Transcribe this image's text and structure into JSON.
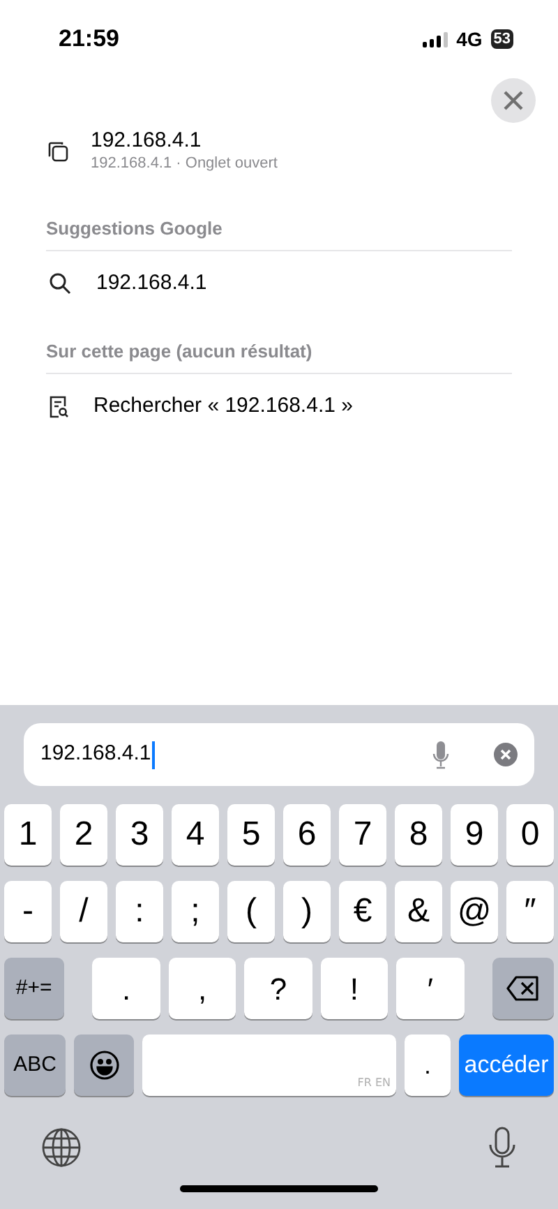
{
  "status_bar": {
    "time": "21:59",
    "network": "4G",
    "battery": "53"
  },
  "open_tab": {
    "title": "192.168.4.1",
    "subtitle": "192.168.4.1 · Onglet ouvert"
  },
  "sections": [
    {
      "header": "Suggestions Google",
      "rows": [
        {
          "kind": "search",
          "text": "192.168.4.1"
        }
      ]
    },
    {
      "header": "Sur cette page (aucun résultat)",
      "rows": [
        {
          "kind": "find",
          "text": "Rechercher « 192.168.4.1 »"
        }
      ]
    }
  ],
  "address_field": {
    "value": "192.168.4.1"
  },
  "keyboard": {
    "rows": [
      {
        "keys": [
          {
            "kind": "char",
            "label": "1"
          },
          {
            "kind": "char",
            "label": "2"
          },
          {
            "kind": "char",
            "label": "3"
          },
          {
            "kind": "char",
            "label": "4"
          },
          {
            "kind": "char",
            "label": "5"
          },
          {
            "kind": "char",
            "label": "6"
          },
          {
            "kind": "char",
            "label": "7"
          },
          {
            "kind": "char",
            "label": "8"
          },
          {
            "kind": "char",
            "label": "9"
          },
          {
            "kind": "char",
            "label": "0"
          }
        ]
      },
      {
        "keys": [
          {
            "kind": "char",
            "label": "-"
          },
          {
            "kind": "char",
            "label": "/"
          },
          {
            "kind": "char",
            "label": ":"
          },
          {
            "kind": "char",
            "label": ";"
          },
          {
            "kind": "char",
            "label": "("
          },
          {
            "kind": "char",
            "label": ")"
          },
          {
            "kind": "char",
            "label": "€"
          },
          {
            "kind": "char",
            "label": "&"
          },
          {
            "kind": "char",
            "label": "@"
          },
          {
            "kind": "char",
            "label": "″"
          }
        ]
      },
      {
        "keys": [
          {
            "kind": "function",
            "label": "#+="
          },
          {
            "kind": "wide",
            "label": "."
          },
          {
            "kind": "wide",
            "label": ","
          },
          {
            "kind": "wide",
            "label": "?"
          },
          {
            "kind": "wide",
            "label": "!"
          },
          {
            "kind": "wide",
            "label": "′"
          },
          {
            "kind": "delete"
          }
        ]
      },
      {
        "keys": [
          {
            "kind": "function",
            "label": "ABC"
          },
          {
            "kind": "emoji"
          },
          {
            "kind": "space",
            "label": "FR EN"
          },
          {
            "kind": "narrow",
            "label": "."
          },
          {
            "kind": "go",
            "label": "accéder"
          }
        ]
      }
    ]
  }
}
